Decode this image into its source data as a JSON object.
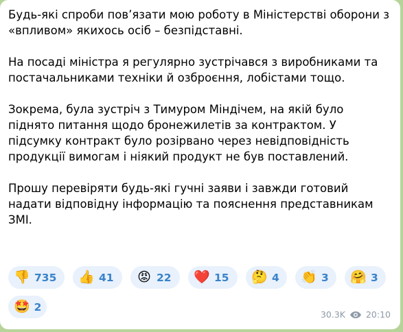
{
  "message": {
    "paragraphs": [
      "Будь-які спроби пов’язати мою роботу в Міністерстві оборони з «впливом» якихось осіб – безпідставні.",
      "На посаді міністра я регулярно зустрічався з виробниками та постачальниками техніки й озброєння, лобістами тощо.",
      "Зокрема, була зустріч з Тимуром Міндічем, на якій було піднято питання щодо бронежилетів за контрактом. У підсумку контракт було розірвано через невідповідність продукції вимогам і ніякий продукт не був поставлений.",
      "Прошу перевіряти будь-які гучні заяви і завжди готовий надати відповідну інформацію та пояснення представникам ЗМІ."
    ]
  },
  "reactions": [
    {
      "emoji": "👎",
      "count": "735",
      "name": "thumbs-down"
    },
    {
      "emoji": "👍",
      "count": "41",
      "name": "thumbs-up"
    },
    {
      "emoji": "😡",
      "count": "22",
      "name": "angry-face"
    },
    {
      "emoji": "❤️",
      "count": "15",
      "name": "red-heart"
    },
    {
      "emoji": "🤔",
      "count": "4",
      "name": "thinking-face"
    },
    {
      "emoji": "👏",
      "count": "3",
      "name": "clapping-hands"
    },
    {
      "emoji": "🤗",
      "count": "3",
      "name": "hugging-face"
    },
    {
      "emoji": "🤩",
      "count": "2",
      "name": "star-struck"
    }
  ],
  "meta": {
    "views": "30.3K",
    "time": "20:10",
    "views_icon": "eye-icon"
  },
  "colors": {
    "background": "#b6d49a",
    "bubble": "#ffffff",
    "reaction_bg": "#e8f1fc",
    "reaction_count": "#3a83c9",
    "meta": "#8d9aa6"
  }
}
